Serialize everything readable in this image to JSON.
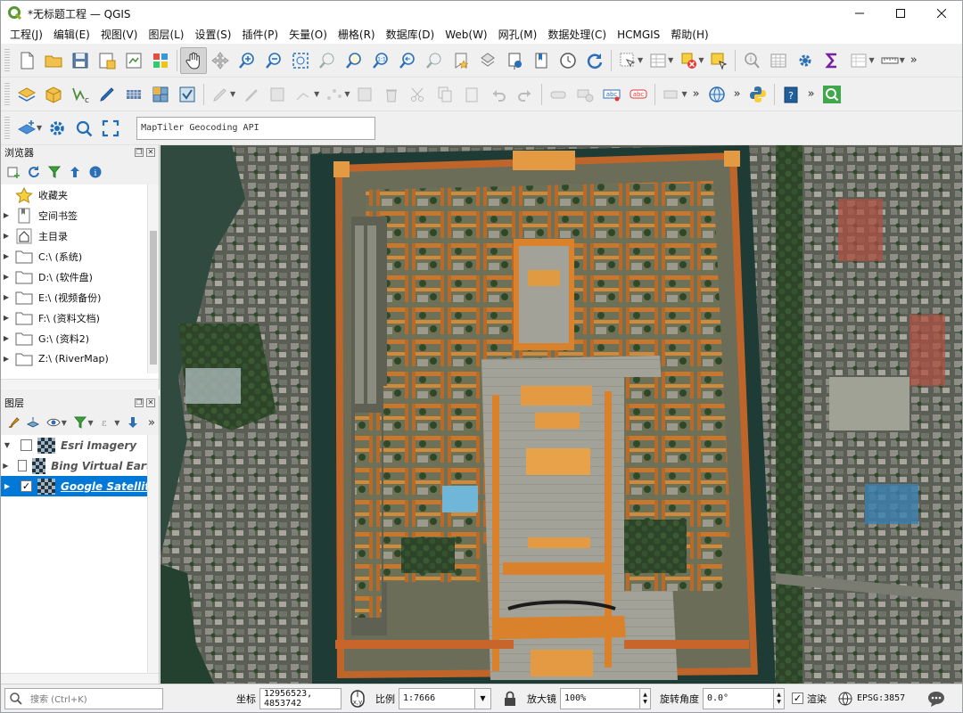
{
  "window": {
    "title": "*无标题工程 — QGIS"
  },
  "menu": [
    "工程(J)",
    "编辑(E)",
    "视图(V)",
    "图层(L)",
    "设置(S)",
    "插件(P)",
    "矢量(O)",
    "栅格(R)",
    "数据库(D)",
    "Web(W)",
    "网孔(M)",
    "数据处理(C)",
    "HCMGIS",
    "帮助(H)"
  ],
  "geocoder": {
    "placeholder": "MapTiler Geocoding API"
  },
  "browser": {
    "title": "浏览器",
    "items": [
      {
        "label": "收藏夹",
        "icon": "star-icon"
      },
      {
        "label": "空间书签",
        "icon": "bookmark-icon"
      },
      {
        "label": "主目录",
        "icon": "home-icon"
      },
      {
        "label": "C:\\ (系统)",
        "icon": "folder-icon"
      },
      {
        "label": "D:\\ (软件盘)",
        "icon": "folder-icon"
      },
      {
        "label": "E:\\ (视频备份)",
        "icon": "folder-icon"
      },
      {
        "label": "F:\\ (资料文档)",
        "icon": "folder-icon"
      },
      {
        "label": "G:\\ (资料2)",
        "icon": "folder-icon"
      },
      {
        "label": "Z:\\ (RiverMap)",
        "icon": "folder-icon"
      }
    ]
  },
  "layers": {
    "title": "图层",
    "items": [
      {
        "name": "Esri Imagery",
        "checked": false,
        "selected": false,
        "expanded": true
      },
      {
        "name": "Bing Virtual Earth",
        "checked": false,
        "selected": false,
        "expanded": false
      },
      {
        "name": "Google Satellite",
        "checked": true,
        "selected": true,
        "expanded": false
      }
    ]
  },
  "status": {
    "search_placeholder": "搜索 (Ctrl+K)",
    "coord_label": "坐标",
    "coord_value": "12956523, 4853742",
    "scale_label": "比例",
    "scale_value": "1:7666",
    "magnifier_label": "放大镜",
    "magnifier_value": "100%",
    "rotation_label": "旋转角度",
    "rotation_value": "0.0°",
    "render_label": "渲染",
    "render_checked": true,
    "crs": "EPSG:3857"
  },
  "colors": {
    "selection": "#0078d7",
    "roof": "#d9822b",
    "wall": "#c8652a",
    "moat": "#1f3b36"
  }
}
